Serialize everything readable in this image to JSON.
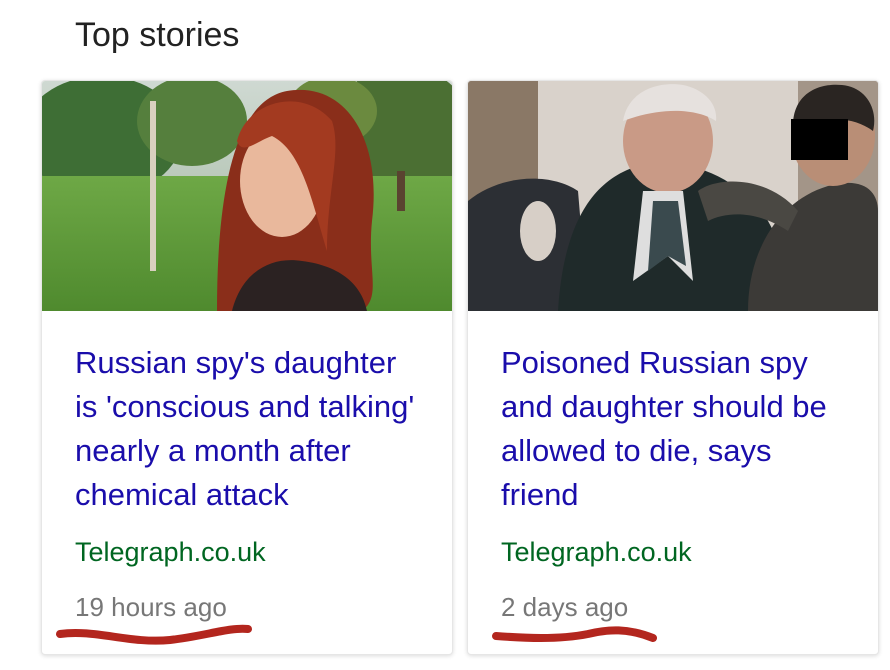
{
  "section": {
    "title": "Top stories"
  },
  "stories": [
    {
      "headline": "Russian spy's daughter is 'conscious and talking' nearly a month after chemical attack",
      "source": "Telegraph.co.uk",
      "time": "19 hours ago"
    },
    {
      "headline": "Poisoned Russian spy and daughter should be allowed to die, says friend",
      "source": "Telegraph.co.uk",
      "time": "2 days ago"
    }
  ],
  "colors": {
    "headline": "#1a0dab",
    "source": "#006621",
    "time": "#777777",
    "marker": "#b3261e"
  },
  "icons": [
    "red-underline-annotation"
  ]
}
